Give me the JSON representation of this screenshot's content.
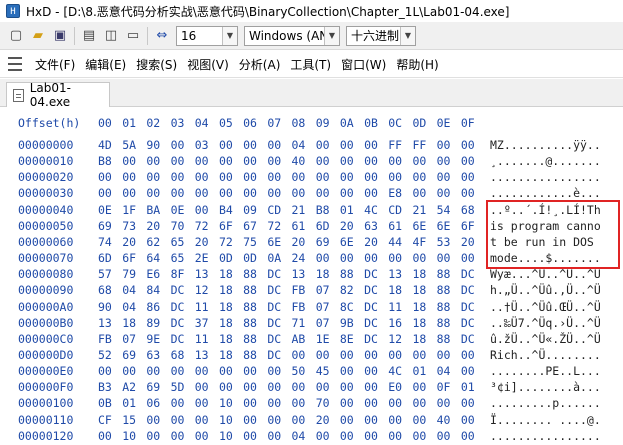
{
  "window": {
    "title": "HxD - [D:\\8.恶意代码分析实战\\恶意代码\\BinaryCollection\\Chapter_1L\\Lab01-04.exe]"
  },
  "toolbar": {
    "bytes_per_row": "16",
    "charset": "Windows (AN",
    "offset_base": "十六进制"
  },
  "menu": [
    "文件(F)",
    "编辑(E)",
    "搜索(S)",
    "视图(V)",
    "分析(A)",
    "工具(T)",
    "窗口(W)",
    "帮助(H)"
  ],
  "tab": {
    "label": "Lab01-04.exe"
  },
  "hex": {
    "offset_header": "Offset(h)",
    "columns": [
      "00",
      "01",
      "02",
      "03",
      "04",
      "05",
      "06",
      "07",
      "08",
      "09",
      "0A",
      "0B",
      "0C",
      "0D",
      "0E",
      "0F"
    ],
    "rows": [
      {
        "offset": "00000000",
        "bytes": [
          "4D",
          "5A",
          "90",
          "00",
          "03",
          "00",
          "00",
          "00",
          "04",
          "00",
          "00",
          "00",
          "FF",
          "FF",
          "00",
          "00"
        ],
        "ascii": "MZ..........ÿÿ.."
      },
      {
        "offset": "00000010",
        "bytes": [
          "B8",
          "00",
          "00",
          "00",
          "00",
          "00",
          "00",
          "00",
          "40",
          "00",
          "00",
          "00",
          "00",
          "00",
          "00",
          "00"
        ],
        "ascii": "¸.......@......."
      },
      {
        "offset": "00000020",
        "bytes": [
          "00",
          "00",
          "00",
          "00",
          "00",
          "00",
          "00",
          "00",
          "00",
          "00",
          "00",
          "00",
          "00",
          "00",
          "00",
          "00"
        ],
        "ascii": "................"
      },
      {
        "offset": "00000030",
        "bytes": [
          "00",
          "00",
          "00",
          "00",
          "00",
          "00",
          "00",
          "00",
          "00",
          "00",
          "00",
          "00",
          "E8",
          "00",
          "00",
          "00"
        ],
        "ascii": "............è..."
      },
      {
        "offset": "00000040",
        "bytes": [
          "0E",
          "1F",
          "BA",
          "0E",
          "00",
          "B4",
          "09",
          "CD",
          "21",
          "B8",
          "01",
          "4C",
          "CD",
          "21",
          "54",
          "68"
        ],
        "ascii": "..º..´.Í!¸.LÍ!Th"
      },
      {
        "offset": "00000050",
        "bytes": [
          "69",
          "73",
          "20",
          "70",
          "72",
          "6F",
          "67",
          "72",
          "61",
          "6D",
          "20",
          "63",
          "61",
          "6E",
          "6E",
          "6F"
        ],
        "ascii": "is program canno"
      },
      {
        "offset": "00000060",
        "bytes": [
          "74",
          "20",
          "62",
          "65",
          "20",
          "72",
          "75",
          "6E",
          "20",
          "69",
          "6E",
          "20",
          "44",
          "4F",
          "53",
          "20"
        ],
        "ascii": "t be run in DOS "
      },
      {
        "offset": "00000070",
        "bytes": [
          "6D",
          "6F",
          "64",
          "65",
          "2E",
          "0D",
          "0D",
          "0A",
          "24",
          "00",
          "00",
          "00",
          "00",
          "00",
          "00",
          "00"
        ],
        "ascii": "mode....$......."
      },
      {
        "offset": "00000080",
        "bytes": [
          "57",
          "79",
          "E6",
          "8F",
          "13",
          "18",
          "88",
          "DC",
          "13",
          "18",
          "88",
          "DC",
          "13",
          "18",
          "88",
          "DC"
        ],
        "ascii": "Wyæ...^Ü..^Ü..^Ü"
      },
      {
        "offset": "00000090",
        "bytes": [
          "68",
          "04",
          "84",
          "DC",
          "12",
          "18",
          "88",
          "DC",
          "FB",
          "07",
          "82",
          "DC",
          "18",
          "18",
          "88",
          "DC"
        ],
        "ascii": "h.„Ü..^Üû.‚Ü..^Ü"
      },
      {
        "offset": "000000A0",
        "bytes": [
          "90",
          "04",
          "86",
          "DC",
          "11",
          "18",
          "88",
          "DC",
          "FB",
          "07",
          "8C",
          "DC",
          "11",
          "18",
          "88",
          "DC"
        ],
        "ascii": "..†Ü..^Üû.ŒÜ..^Ü"
      },
      {
        "offset": "000000B0",
        "bytes": [
          "13",
          "18",
          "89",
          "DC",
          "37",
          "18",
          "88",
          "DC",
          "71",
          "07",
          "9B",
          "DC",
          "16",
          "18",
          "88",
          "DC"
        ],
        "ascii": "..‰Ü7.^Üq.›Ü..^Ü"
      },
      {
        "offset": "000000C0",
        "bytes": [
          "FB",
          "07",
          "9E",
          "DC",
          "11",
          "18",
          "88",
          "DC",
          "AB",
          "1E",
          "8E",
          "DC",
          "12",
          "18",
          "88",
          "DC"
        ],
        "ascii": "û.žÜ..^Ü«.ŽÜ..^Ü"
      },
      {
        "offset": "000000D0",
        "bytes": [
          "52",
          "69",
          "63",
          "68",
          "13",
          "18",
          "88",
          "DC",
          "00",
          "00",
          "00",
          "00",
          "00",
          "00",
          "00",
          "00"
        ],
        "ascii": "Rich..^Ü........"
      },
      {
        "offset": "000000E0",
        "bytes": [
          "00",
          "00",
          "00",
          "00",
          "00",
          "00",
          "00",
          "00",
          "50",
          "45",
          "00",
          "00",
          "4C",
          "01",
          "04",
          "00"
        ],
        "ascii": "........PE..L..."
      },
      {
        "offset": "000000F0",
        "bytes": [
          "B3",
          "A2",
          "69",
          "5D",
          "00",
          "00",
          "00",
          "00",
          "00",
          "00",
          "00",
          "00",
          "E0",
          "00",
          "0F",
          "01"
        ],
        "ascii": "³¢i]........à..."
      },
      {
        "offset": "00000100",
        "bytes": [
          "0B",
          "01",
          "06",
          "00",
          "00",
          "10",
          "00",
          "00",
          "00",
          "70",
          "00",
          "00",
          "00",
          "00",
          "00",
          "00"
        ],
        "ascii": ".........p......"
      },
      {
        "offset": "00000110",
        "bytes": [
          "CF",
          "15",
          "00",
          "00",
          "00",
          "10",
          "00",
          "00",
          "00",
          "20",
          "00",
          "00",
          "00",
          "00",
          "40",
          "00"
        ],
        "ascii": "Ï........ ....@."
      },
      {
        "offset": "00000120",
        "bytes": [
          "00",
          "10",
          "00",
          "00",
          "00",
          "10",
          "00",
          "00",
          "04",
          "00",
          "00",
          "00",
          "00",
          "00",
          "00",
          "00"
        ],
        "ascii": "................"
      }
    ]
  },
  "colors": {
    "hex_text": "#1f4aa8",
    "highlight_box": "#e02424"
  }
}
